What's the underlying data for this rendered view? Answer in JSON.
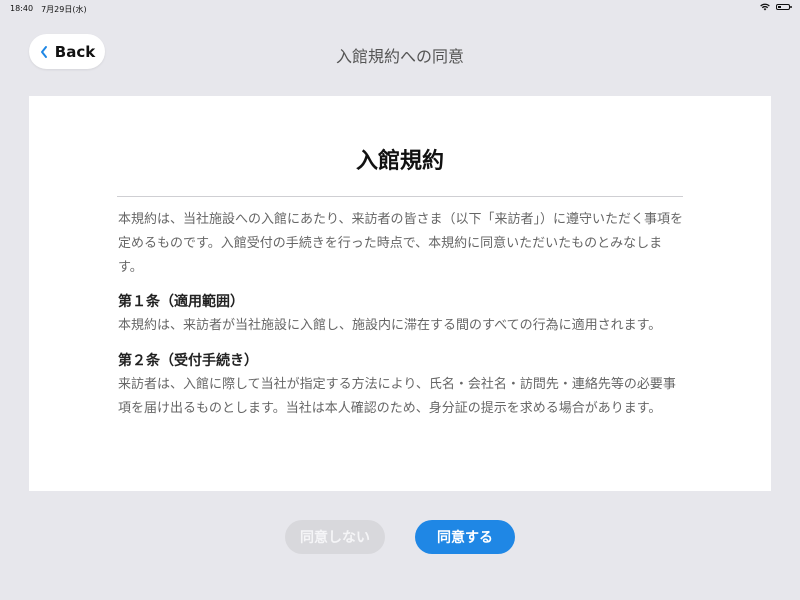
{
  "status_bar": {
    "time": "18:40",
    "date": "7月29日(水)"
  },
  "header": {
    "back_label": "Back",
    "title": "入館規約への同意"
  },
  "document": {
    "heading": "入館規約",
    "intro": "本規約は、当社施設への入館にあたり、来訪者の皆さま（以下「来訪者」）に遵守いただく事項を定めるものです。入館受付の手続きを行った時点で、本規約に同意いただいたものとみなします。",
    "articles": [
      {
        "title": "第１条（適用範囲）",
        "text": "本規約は、来訪者が当社施設に入館し、施設内に滞在する間のすべての行為に適用されます。"
      },
      {
        "title": "第２条（受付手続き）",
        "text": "来訪者は、入館に際して当社が指定する方法により、氏名・会社名・訪問先・連絡先等の必要事項を届け出るものとします。当社は本人確認のため、身分証の提示を求める場合があります。"
      }
    ]
  },
  "actions": {
    "disagree_label": "同意しない",
    "agree_label": "同意する"
  },
  "colors": {
    "background": "#e7e7ec",
    "accent": "#1f87e5",
    "disabled": "#d8d8dc"
  }
}
